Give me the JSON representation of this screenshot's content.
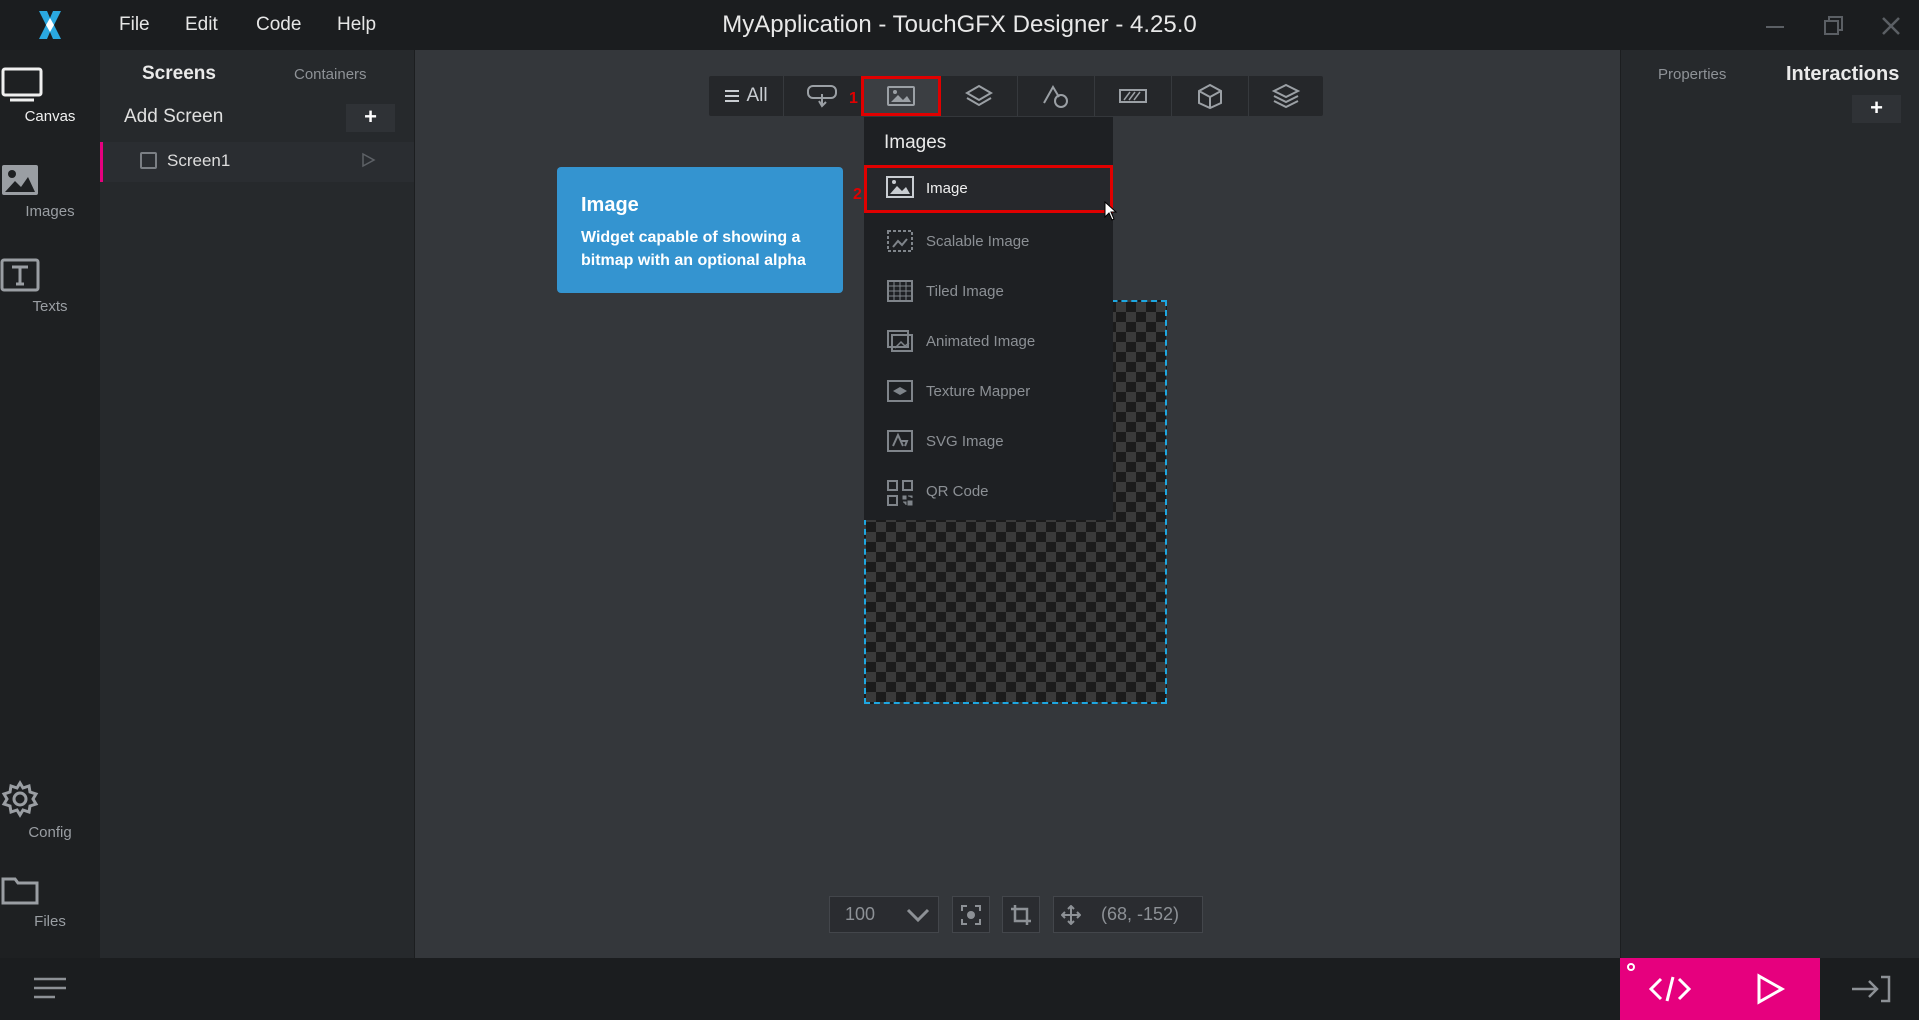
{
  "app": {
    "title": "MyApplication - TouchGFX Designer - 4.25.0",
    "menu": [
      "File",
      "Edit",
      "Code",
      "Help"
    ]
  },
  "nav": {
    "canvas": "Canvas",
    "images": "Images",
    "texts": "Texts",
    "config": "Config",
    "files": "Files"
  },
  "screens_panel": {
    "tab_screens": "Screens",
    "tab_containers": "Containers",
    "add_screen": "Add Screen",
    "add_symbol": "+",
    "screens": [
      "Screen1"
    ]
  },
  "toolbar": {
    "all_label": "All",
    "step1": "1",
    "step2": "2"
  },
  "dropdown": {
    "title": "Images",
    "items": [
      "Image",
      "Scalable Image",
      "Tiled Image",
      "Animated Image",
      "Texture Mapper",
      "SVG Image",
      "QR Code"
    ]
  },
  "tooltip": {
    "title": "Image",
    "body": "Widget capable of showing a bitmap with an optional alpha"
  },
  "canvas_controls": {
    "zoom": "100",
    "coordinates": "(68, -152)"
  },
  "right_panel": {
    "tab_properties": "Properties",
    "tab_interactions": "Interactions",
    "add_symbol": "+"
  },
  "colors": {
    "accent": "#e6007e",
    "highlight": "#e00000",
    "tooltip": "#3494d0",
    "selection": "#1ea7e1"
  }
}
